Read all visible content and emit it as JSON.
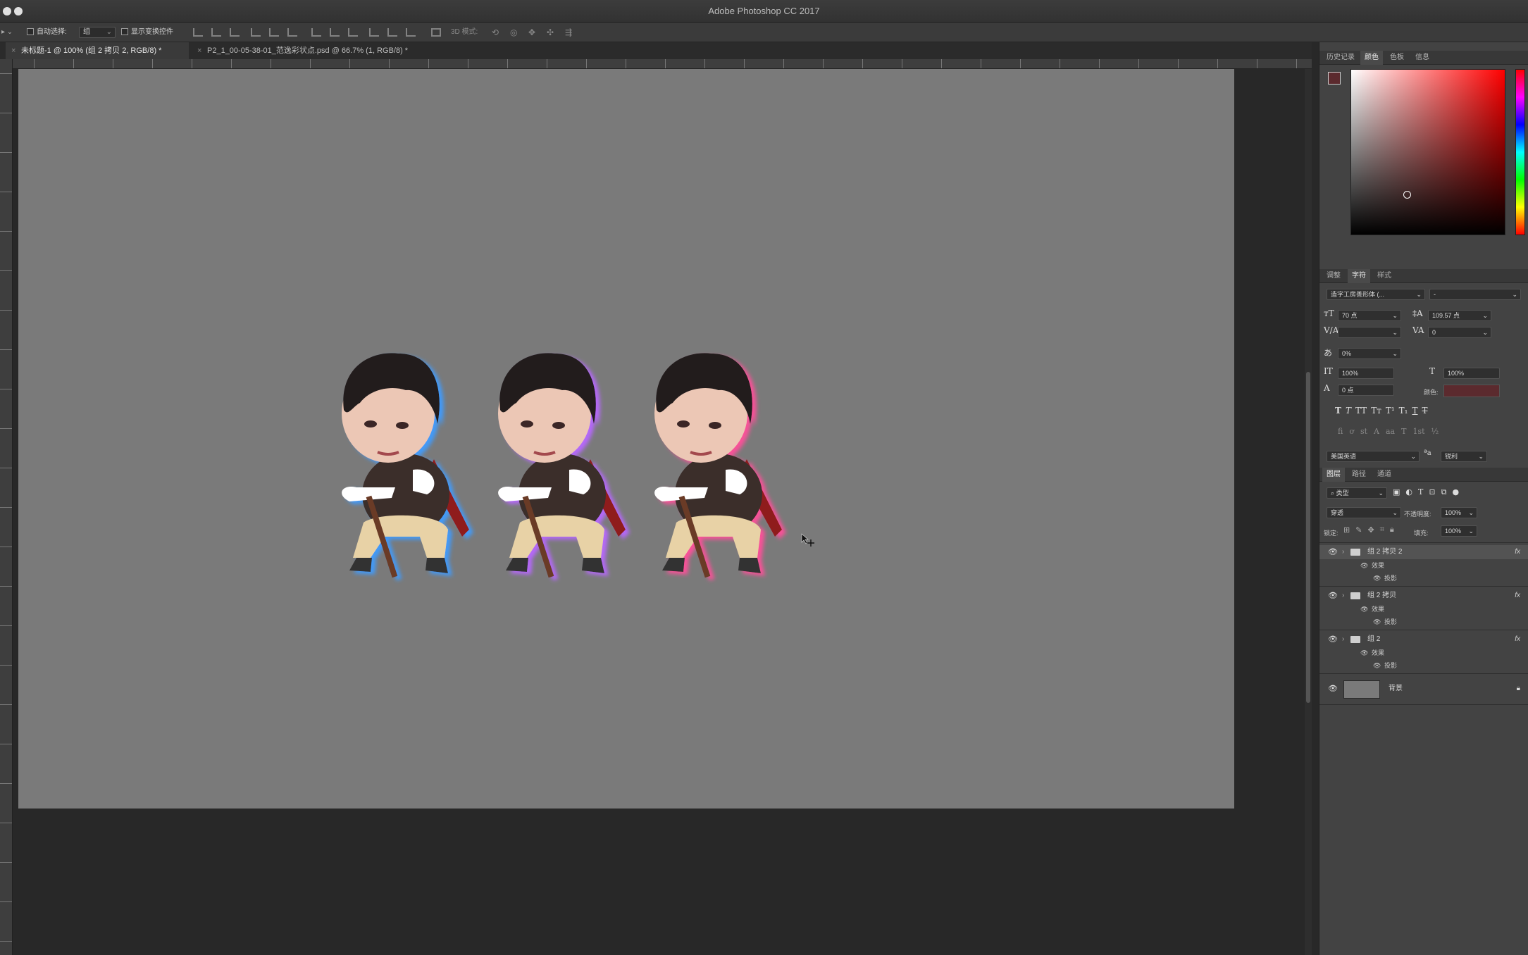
{
  "window": {
    "title": "Adobe Photoshop CC 2017"
  },
  "options_bar": {
    "auto_select_label": "自动选择:",
    "auto_select_value": "组",
    "show_transform_label": "显示变换控件",
    "mode_3d_label": "3D 模式:"
  },
  "tabs": [
    {
      "label": "未标题-1 @ 100% (组 2 拷贝 2, RGB/8) *",
      "active": true
    },
    {
      "label": "P2_1_00-05-38-01_范逸彩状点.psd @ 66.7% (1, RGB/8) *",
      "active": false
    }
  ],
  "colors": {
    "canvas": "#7a7a7a",
    "pasteboard": "#282828",
    "foreground": "#5b2a2e",
    "glow_left": "#3f9bff",
    "glow_mid": "#b768ff",
    "glow_right": "#ff4f9a"
  },
  "color_panel": {
    "tabs": [
      "历史记录",
      "颜色",
      "色板",
      "信息"
    ],
    "active_tab": "颜色"
  },
  "character_panel": {
    "tabs": [
      "调整",
      "字符",
      "样式"
    ],
    "active_tab": "字符",
    "font_family": "造字工房善形体 (...",
    "font_style": "-",
    "size": "70 点",
    "leading": "109.57 点",
    "kerning": "",
    "tracking": "0",
    "tsume": "0%",
    "vertical_scale": "100%",
    "horizontal_scale": "100%",
    "baseline_shift": "0 点",
    "color_label": "颜色:",
    "language": "美国英语",
    "antialias": "锐利"
  },
  "layers_panel": {
    "tabs": [
      "图层",
      "路径",
      "通道"
    ],
    "active_tab": "图层",
    "filter_kind": "类型",
    "blend_mode": "穿透",
    "opacity_label": "不透明度:",
    "opacity": "100%",
    "lock_label": "锁定:",
    "fill_label": "填充:",
    "fill": "100%",
    "layers": [
      {
        "name": "组 2 拷贝 2",
        "type": "group",
        "selected": true,
        "fx": "fx",
        "effects_label": "效果",
        "effect": "投影"
      },
      {
        "name": "组 2 拷贝",
        "type": "group",
        "selected": false,
        "fx": "fx",
        "effects_label": "效果",
        "effect": "投影"
      },
      {
        "name": "组 2",
        "type": "group",
        "selected": false,
        "fx": "fx",
        "effects_label": "效果",
        "effect": "投影"
      },
      {
        "name": "背景",
        "type": "background",
        "selected": false
      }
    ]
  }
}
